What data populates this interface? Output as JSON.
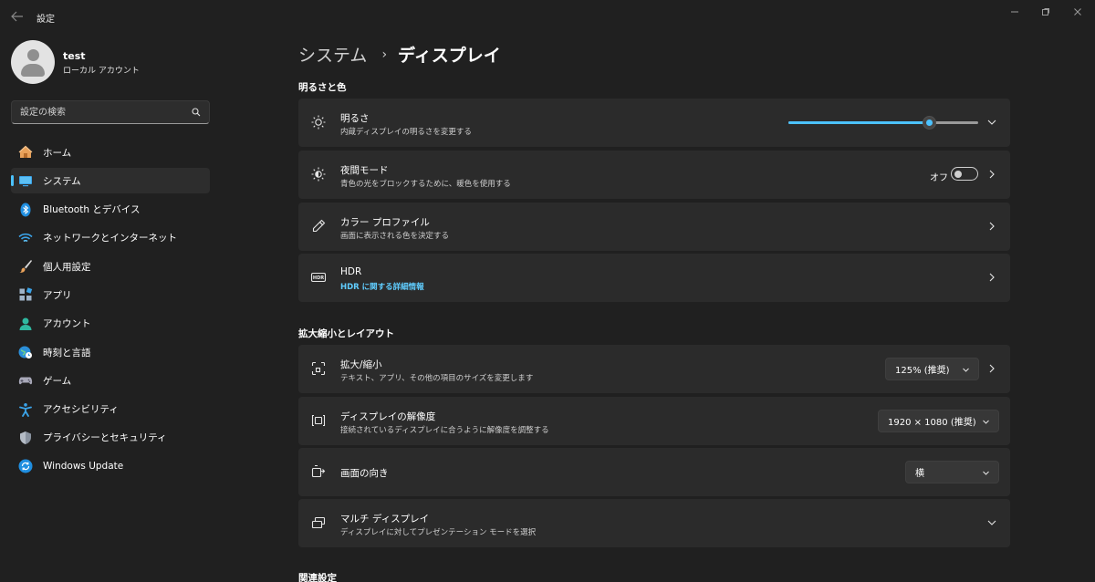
{
  "window": {
    "title": "設定",
    "controls": {
      "minimize": "—",
      "maximize": "❐",
      "close": "✕"
    }
  },
  "profile": {
    "name": "test",
    "account_type": "ローカル アカウント"
  },
  "search": {
    "placeholder": "設定の検索"
  },
  "sidebar": {
    "items": [
      {
        "label": "ホーム",
        "icon": "home-icon"
      },
      {
        "label": "システム",
        "icon": "system-icon",
        "active": true
      },
      {
        "label": "Bluetooth とデバイス",
        "icon": "bluetooth-icon"
      },
      {
        "label": "ネットワークとインターネット",
        "icon": "wifi-icon"
      },
      {
        "label": "個人用設定",
        "icon": "brush-icon"
      },
      {
        "label": "アプリ",
        "icon": "apps-icon"
      },
      {
        "label": "アカウント",
        "icon": "account-icon"
      },
      {
        "label": "時刻と言語",
        "icon": "globe-clock-icon"
      },
      {
        "label": "ゲーム",
        "icon": "gamepad-icon"
      },
      {
        "label": "アクセシビリティ",
        "icon": "accessibility-icon"
      },
      {
        "label": "プライバシーとセキュリティ",
        "icon": "shield-icon"
      },
      {
        "label": "Windows Update",
        "icon": "update-icon"
      }
    ]
  },
  "breadcrumb": {
    "parent": "システム",
    "separator": "›",
    "current": "ディスプレイ"
  },
  "sections": {
    "brightness_color": {
      "title": "明るさと色",
      "brightness": {
        "title": "明るさ",
        "subtitle": "内蔵ディスプレイの明るさを変更する",
        "value_percent": 74
      },
      "night_light": {
        "title": "夜間モード",
        "subtitle": "青色の光をブロックするために、暖色を使用する",
        "state_label": "オフ",
        "on": false
      },
      "color_profile": {
        "title": "カラー プロファイル",
        "subtitle": "画面に表示される色を決定する"
      },
      "hdr": {
        "title": "HDR",
        "subtitle": "HDR に関する詳細情報"
      }
    },
    "scale_layout": {
      "title": "拡大縮小とレイアウト",
      "scale": {
        "title": "拡大/縮小",
        "subtitle": "テキスト、アプリ、その他の項目のサイズを変更します",
        "value": "125% (推奨)"
      },
      "resolution": {
        "title": "ディスプレイの解像度",
        "subtitle": "接続されているディスプレイに合うように解像度を調整する",
        "value": "1920 × 1080 (推奨)"
      },
      "orientation": {
        "title": "画面の向き",
        "value": "横"
      },
      "multi_display": {
        "title": "マルチ ディスプレイ",
        "subtitle": "ディスプレイに対してプレゼンテーション モードを選択"
      }
    },
    "related": {
      "title": "関連設定"
    }
  },
  "colors": {
    "accent": "#4cc2ff",
    "link": "#60cdff",
    "background": "#202020",
    "card": "#2b2b2b"
  }
}
